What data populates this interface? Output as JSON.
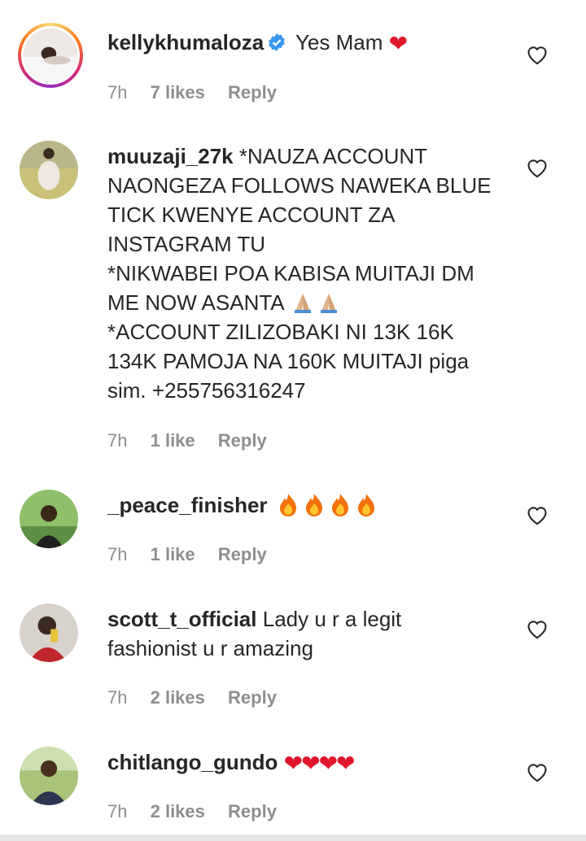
{
  "comments": [
    {
      "username": "kellykhumaloza",
      "verified": true,
      "text": "Yes Mam",
      "time": "7h",
      "likes": "7 likes",
      "reply": "Reply"
    },
    {
      "username": "muuzaji_27k",
      "text_lines": [
        "*NAUZA ACCOUNT",
        "NAONGEZA FOLLOWS NAWEKA BLUE",
        "TICK KWENYE ACCOUNT ZA",
        "INSTAGRAM TU",
        "*NIKWABEI POA KABISA MUITAJI DM",
        "ME NOW ASANTA",
        "*ACCOUNT ZILIZOBAKI NI 13K 16K",
        "134K PAMOJA NA 160K MUITAJI piga",
        "sim. +255756316247"
      ],
      "time": "7h",
      "likes": "1 like",
      "reply": "Reply"
    },
    {
      "username": "_peace_finisher",
      "text": "",
      "time": "7h",
      "likes": "1 like",
      "reply": "Reply"
    },
    {
      "username": "scott_t_official",
      "text_lines": [
        "Lady u r a legit",
        "fashionist u r amazing"
      ],
      "time": "7h",
      "likes": "2 likes",
      "reply": "Reply"
    },
    {
      "username": "chitlango_gundo",
      "text": "",
      "time": "7h",
      "likes": "2 likes",
      "reply": "Reply"
    }
  ],
  "colors": {
    "text": "#262626",
    "meta": "#8e8e8e",
    "heart": "#e0162b",
    "verified": "#3897f0"
  },
  "icons": {
    "like": "heart-outline-icon",
    "verified": "verified-badge-icon",
    "fire": "fire-emoji-icon",
    "pray": "folded-hands-emoji-icon"
  }
}
